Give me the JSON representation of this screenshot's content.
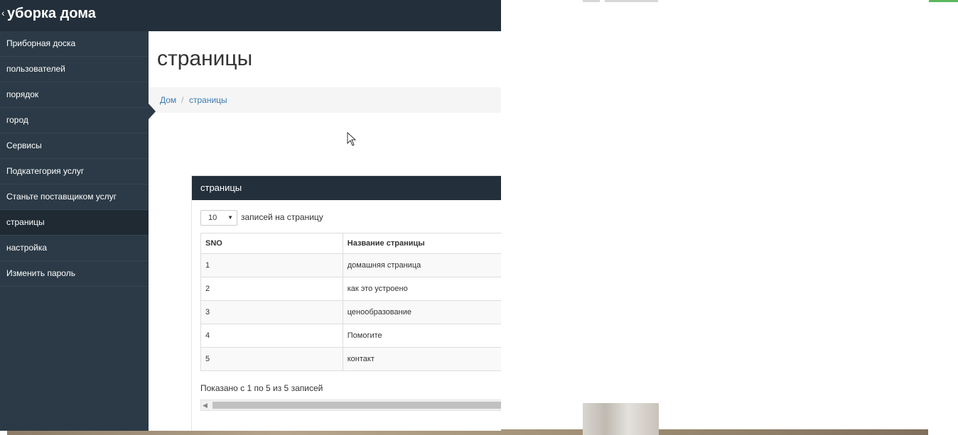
{
  "app": {
    "brand": "уборка дома"
  },
  "sidebar": {
    "items": [
      {
        "label": "Приборная доска"
      },
      {
        "label": "пользователей"
      },
      {
        "label": "порядок"
      },
      {
        "label": "город"
      },
      {
        "label": "Сервисы"
      },
      {
        "label": "Подкатегория услуг"
      },
      {
        "label": "Станьте поставщиком услуг"
      },
      {
        "label": "страницы",
        "active": true
      },
      {
        "label": "настройка"
      },
      {
        "label": "Изменить пароль"
      }
    ]
  },
  "page": {
    "title": "страницы",
    "breadcrumb": {
      "home": "Дом",
      "separator": "/",
      "current": "страницы"
    }
  },
  "panel": {
    "title": "страницы",
    "page_length": {
      "value": "10",
      "label": "записей на страницу"
    },
    "table": {
      "columns": [
        "SNO",
        "Название страницы"
      ],
      "rows": [
        [
          "1",
          "домашняя страница"
        ],
        [
          "2",
          "как это устроено"
        ],
        [
          "3",
          "ценообразование"
        ],
        [
          "4",
          "Помогите"
        ],
        [
          "5",
          "контакт"
        ]
      ]
    },
    "info": "Показано с 1 по 5 из 5 записей"
  },
  "colors": {
    "topbar": "#232f3a",
    "sidebar": "#2b3a46",
    "link": "#3b7bb0",
    "accent_green": "#5cb85c"
  }
}
